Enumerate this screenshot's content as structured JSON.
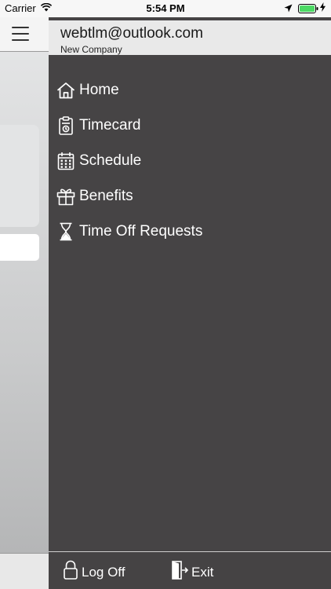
{
  "status_bar": {
    "carrier": "Carrier",
    "time": "5:54 PM"
  },
  "drawer": {
    "user_email": "webtlm@outlook.com",
    "company": "New Company",
    "menu": [
      {
        "label": "Home",
        "icon": "home-icon"
      },
      {
        "label": "Timecard",
        "icon": "timecard-icon"
      },
      {
        "label": "Schedule",
        "icon": "calendar-icon"
      },
      {
        "label": "Benefits",
        "icon": "gift-icon"
      },
      {
        "label": "Time Off Requests",
        "icon": "hourglass-icon"
      }
    ],
    "footer": {
      "logoff_label": "Log Off",
      "exit_label": "Exit"
    }
  },
  "colors": {
    "drawer_bg": "#464445",
    "header_bg": "#e9e9e9",
    "battery": "#4cd964"
  }
}
